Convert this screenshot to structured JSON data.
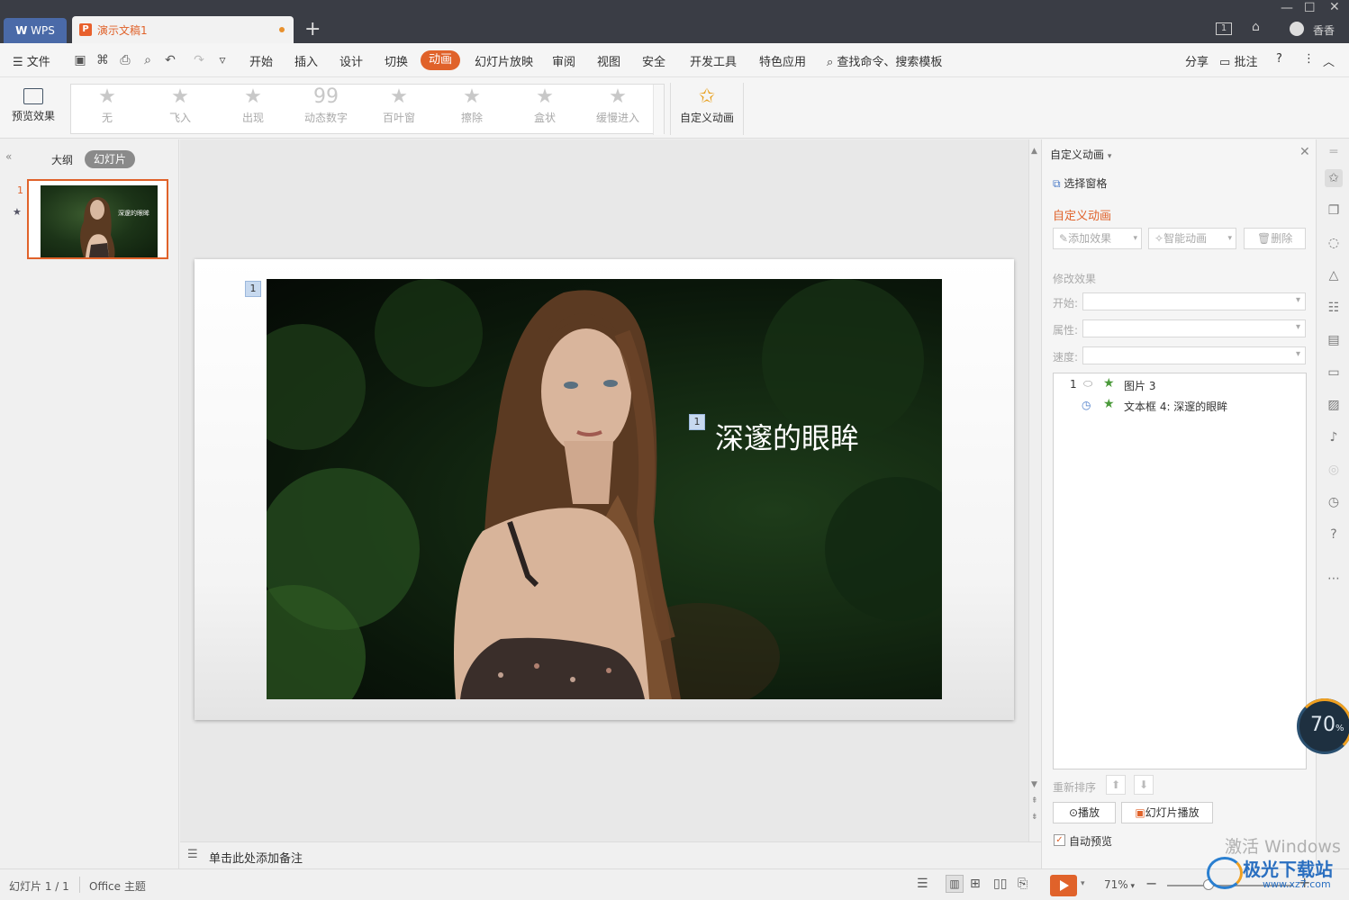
{
  "titlebar": {
    "app_tab": "WPS",
    "doc_tab": "演示文稿1",
    "user_name": "香香"
  },
  "menubar": {
    "file": "文件",
    "items": [
      "开始",
      "插入",
      "设计",
      "切换",
      "动画",
      "幻灯片放映",
      "审阅",
      "视图",
      "安全",
      "开发工具",
      "特色应用"
    ],
    "active": "动画",
    "search": "查找命令、搜索模板",
    "share": "分享",
    "comment": "批注"
  },
  "ribbon": {
    "preview": "预览效果",
    "effects": [
      "无",
      "飞入",
      "出现",
      "动态数字",
      "百叶窗",
      "擦除",
      "盒状",
      "缓慢进入"
    ],
    "custom": "自定义动画"
  },
  "leftpanel": {
    "outline_tab": "大纲",
    "slides_tab": "幻灯片",
    "slide_number": "1",
    "thumb_text": "深邃的眼眸"
  },
  "slide": {
    "tag_picture": "1",
    "tag_text": "1",
    "title_text": "深邃的眼眸"
  },
  "notes_placeholder": "单击此处添加备注",
  "rightpane": {
    "header": "自定义动画",
    "select_pane": "选择窗格",
    "section_title": "自定义动画",
    "add_effect": "添加效果",
    "smart_anim": "智能动画",
    "delete": "删除",
    "modify_label": "修改效果",
    "start_label": "开始:",
    "prop_label": "属性:",
    "speed_label": "速度:",
    "list": [
      {
        "num": "1",
        "name": "图片 3"
      },
      {
        "num": "",
        "name": "文本框 4: 深邃的眼眸"
      }
    ],
    "reorder": "重新排序",
    "play": "播放",
    "slideshow": "幻灯片播放",
    "autopreview": "自动预览"
  },
  "statusbar": {
    "slide_info": "幻灯片 1 / 1",
    "theme": "Office 主题",
    "zoom": "71%"
  },
  "overlay": {
    "activate": "激活 Windows",
    "gauge_value": "70",
    "gauge_unit": "%",
    "watermark": "极光下载站",
    "watermark_url": "www.xz7.com"
  },
  "colors": {
    "accent": "#e0622a",
    "titlebar": "#3a3d45"
  }
}
